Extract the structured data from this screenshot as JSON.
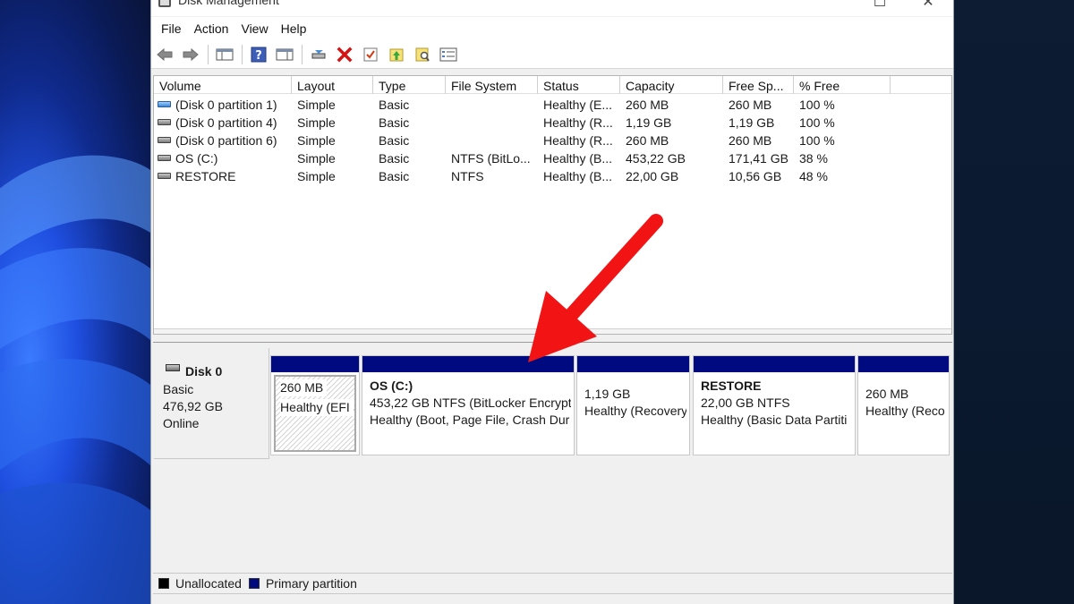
{
  "window": {
    "title": "Disk Management",
    "minimize_glyph": "☐",
    "close_glyph": "✕"
  },
  "menu": [
    "File",
    "Action",
    "View",
    "Help"
  ],
  "toolbar": {
    "buttons": [
      "back-icon",
      "forward-icon",
      "console-tree-icon",
      "help-icon",
      "properties-pane-icon",
      "connect-disk-icon",
      "delete-icon",
      "check-icon",
      "import-up-icon",
      "find-icon",
      "settings-list-icon"
    ]
  },
  "volume_list": {
    "columns": [
      "Volume",
      "Layout",
      "Type",
      "File System",
      "Status",
      "Capacity",
      "Free Sp...",
      "% Free"
    ],
    "rows": [
      {
        "icon": "drive-blue-icon",
        "volume": "(Disk 0 partition 1)",
        "layout": "Simple",
        "type": "Basic",
        "fs": "",
        "status": "Healthy (E...",
        "capacity": "260 MB",
        "free": "260 MB",
        "pct": "100 %"
      },
      {
        "icon": "drive-icon",
        "volume": "(Disk 0 partition 4)",
        "layout": "Simple",
        "type": "Basic",
        "fs": "",
        "status": "Healthy (R...",
        "capacity": "1,19 GB",
        "free": "1,19 GB",
        "pct": "100 %"
      },
      {
        "icon": "drive-icon",
        "volume": "(Disk 0 partition 6)",
        "layout": "Simple",
        "type": "Basic",
        "fs": "",
        "status": "Healthy (R...",
        "capacity": "260 MB",
        "free": "260 MB",
        "pct": "100 %"
      },
      {
        "icon": "drive-icon",
        "volume": "OS (C:)",
        "layout": "Simple",
        "type": "Basic",
        "fs": "NTFS (BitLo...",
        "status": "Healthy (B...",
        "capacity": "453,22 GB",
        "free": "171,41 GB",
        "pct": "38 %"
      },
      {
        "icon": "drive-icon",
        "volume": "RESTORE",
        "layout": "Simple",
        "type": "Basic",
        "fs": "NTFS",
        "status": "Healthy (B...",
        "capacity": "22,00 GB",
        "free": "10,56 GB",
        "pct": "48 %"
      }
    ]
  },
  "disk0": {
    "name": "Disk 0",
    "type": "Basic",
    "size": "476,92 GB",
    "state": "Online",
    "partitions": [
      {
        "title": "",
        "size": "260 MB",
        "status": "Healthy (EFI S"
      },
      {
        "title": "OS  (C:)",
        "size": "453,22 GB NTFS (BitLocker Encrypt",
        "status": "Healthy (Boot, Page File, Crash Dur"
      },
      {
        "title": "",
        "size": "1,19 GB",
        "status": "Healthy (Recovery"
      },
      {
        "title": "RESTORE",
        "size": "22,00 GB NTFS",
        "status": "Healthy (Basic Data Partiti"
      },
      {
        "title": "",
        "size": "260 MB",
        "status": "Healthy (Reco"
      }
    ]
  },
  "legend": {
    "unallocated": "Unallocated",
    "primary": "Primary partition",
    "unallocated_color": "#000000",
    "primary_color": "#000a80"
  },
  "annotation": {
    "arrow_color": "#f21414"
  }
}
